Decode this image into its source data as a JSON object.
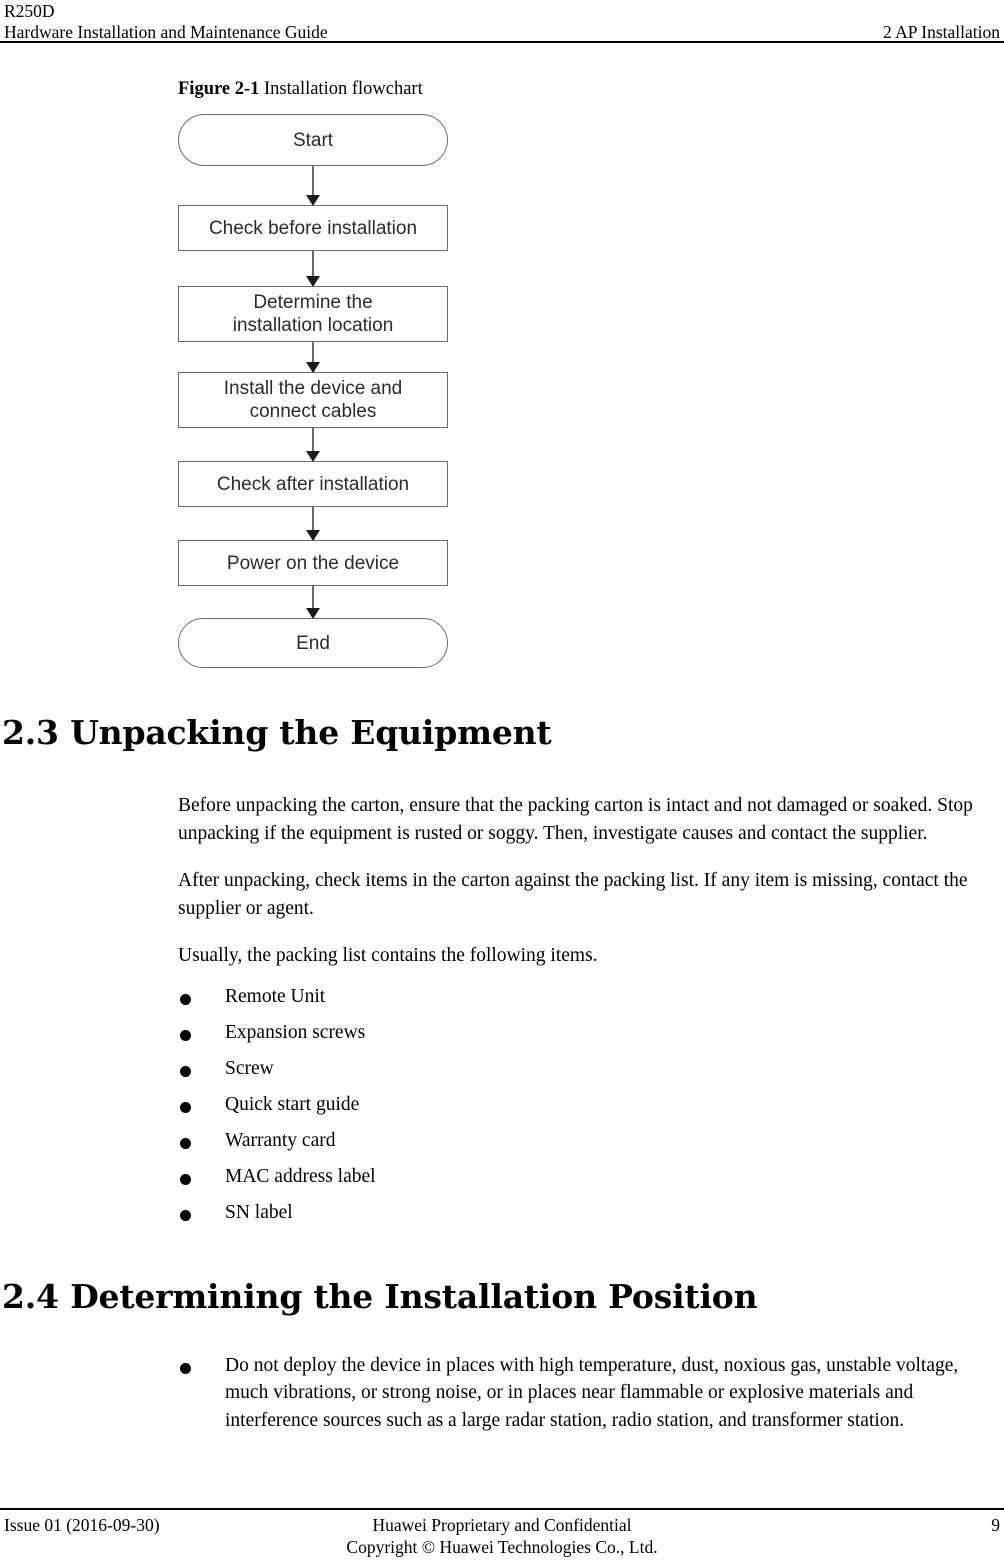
{
  "header": {
    "doc_id": "R250D",
    "guide_title": "Hardware Installation and Maintenance Guide",
    "chapter": "2 AP Installation"
  },
  "figure": {
    "label": "Figure 2-1",
    "caption": "Installation flowchart",
    "chart_data": {
      "type": "flowchart",
      "title": "Installation flowchart",
      "orientation": "top-to-bottom",
      "nodes": [
        {
          "id": "start",
          "label": "Start",
          "shape": "terminator"
        },
        {
          "id": "check_before",
          "label": "Check before installation",
          "shape": "process"
        },
        {
          "id": "determine",
          "label": "Determine the\ninstallation location",
          "shape": "process"
        },
        {
          "id": "install",
          "label": "Install the device and\nconnect cables",
          "shape": "process"
        },
        {
          "id": "check_after",
          "label": "Check after installation",
          "shape": "process"
        },
        {
          "id": "power_on",
          "label": "Power on the device",
          "shape": "process"
        },
        {
          "id": "end",
          "label": "End",
          "shape": "terminator"
        }
      ],
      "edges": [
        {
          "from": "start",
          "to": "check_before",
          "arrow": "down"
        },
        {
          "from": "check_before",
          "to": "determine",
          "arrow": "down"
        },
        {
          "from": "determine",
          "to": "install",
          "arrow": "down"
        },
        {
          "from": "install",
          "to": "check_after",
          "arrow": "down"
        },
        {
          "from": "check_after",
          "to": "power_on",
          "arrow": "down"
        },
        {
          "from": "power_on",
          "to": "end",
          "arrow": "down"
        }
      ],
      "node_border_color": "#6b6b6b",
      "node_text_color": "#2b2b2b"
    },
    "nodes": {
      "start": "Start",
      "check_before": "Check before installation",
      "determine_line1": "Determine the",
      "determine_line2": "installation location",
      "install_line1": "Install the device and",
      "install_line2": "connect cables",
      "check_after": "Check after installation",
      "power_on": "Power on the device",
      "end": "End"
    }
  },
  "section_23": {
    "heading": "2.3 Unpacking the Equipment",
    "para1": "Before unpacking the carton, ensure that the packing carton is intact and not damaged or soaked. Stop unpacking if the equipment is rusted or soggy. Then, investigate causes and contact the supplier.",
    "para2": "After unpacking, check items in the carton against the packing list. If any item is missing, contact the supplier or agent.",
    "para3": "Usually, the packing list contains the following items.",
    "packing_list": [
      "Remote Unit",
      "Expansion screws",
      "Screw",
      "Quick start guide",
      "Warranty card",
      "MAC address label",
      "SN label"
    ]
  },
  "section_24": {
    "heading": "2.4 Determining the Installation Position",
    "items": [
      "Do not deploy the device in places with high temperature, dust, noxious gas, unstable voltage, much vibrations, or strong noise, or in places near flammable or explosive materials and interference sources such as a large radar station, radio station, and transformer station."
    ]
  },
  "footer": {
    "issue": "Issue 01 (2016-09-30)",
    "confidential_line1": "Huawei Proprietary and Confidential",
    "confidential_line2": "Copyright © Huawei Technologies Co., Ltd.",
    "page_number": "9"
  }
}
